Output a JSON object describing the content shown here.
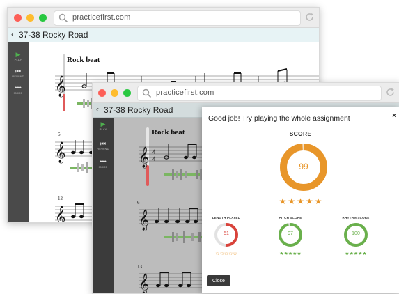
{
  "browser": {
    "url": "practicefirst.com"
  },
  "page": {
    "title": "37-38 Rocky Road"
  },
  "sidebar": {
    "items": [
      {
        "icon": "play-icon",
        "label": "PLAY"
      },
      {
        "icon": "skip-back-icon",
        "label": "REWIND"
      },
      {
        "icon": "more-icon",
        "label": "MORE"
      }
    ]
  },
  "sheet_music": {
    "heading": "Rock beat",
    "measure_numbers": [
      "6",
      "12",
      "13"
    ]
  },
  "modal": {
    "message": "Good job! Try playing the whole assignment",
    "close_x": "×",
    "score_label": "SCORE",
    "score": "99",
    "score_stars": 5,
    "metrics": [
      {
        "label": "LENGTH PLAYED",
        "value": "51",
        "fraction": 0.51,
        "stars": 0,
        "color": "#d9433b"
      },
      {
        "label": "PITCH SCORE",
        "value": "97",
        "fraction": 0.97,
        "stars": 5,
        "color": "#6ab04c"
      },
      {
        "label": "RHYTHM SCORE",
        "value": "100",
        "fraction": 1.0,
        "stars": 5,
        "color": "#6ab04c"
      }
    ],
    "close_button": "Close"
  },
  "colors": {
    "score_orange": "#e8962a",
    "pitch_green": "#6ab04c",
    "length_red": "#d9433b",
    "sidebar_bg": "#4a4a4a",
    "titlebar_bg": "#e7f3f5"
  }
}
